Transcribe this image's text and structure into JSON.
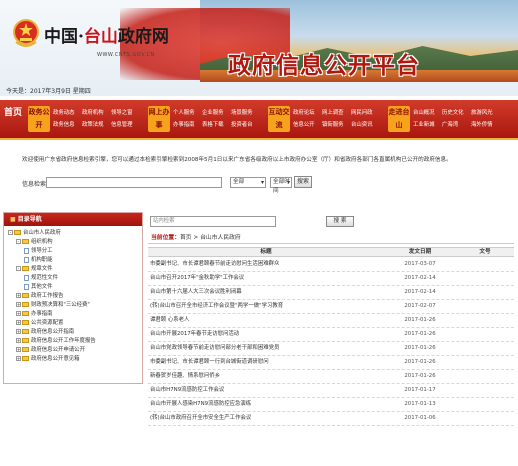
{
  "header": {
    "title_prefix": "中国·",
    "title_city": "台山",
    "title_suffix": "政府网",
    "url": "WWW.CNTS.GOV.CN",
    "platform_title": "政府信息公开平台",
    "date_line": "今天是：2017年3月9日 星期四"
  },
  "nav": {
    "home": "首页",
    "groups": [
      {
        "badge": "政务公开",
        "links": [
          "政务动态",
          "政府机构",
          "领导之窗",
          "政务信息",
          "政策法规",
          "信息管理"
        ]
      },
      {
        "badge": "网上办事",
        "links": [
          "个人服务",
          "企业服务",
          "场景服务",
          "办事指南",
          "表格下载",
          "投资者台"
        ]
      },
      {
        "badge": "互动交流",
        "links": [
          "政府论坛",
          "网上调查",
          "网民问政",
          "信息公开",
          "镇街服务",
          "台山资讯"
        ]
      },
      {
        "badge": "走进台山",
        "links": [
          "台山概况",
          "历史文化",
          "旅游风光",
          "工业新城",
          "广海湾",
          "海外侨情"
        ]
      }
    ]
  },
  "notice": "欢迎使用广东省政府信息检索引擎，您可以通过本检索引擎检索到2008年5月1日以来广东省各级政府以上市政府办公室（厅）和省政府各部门各直属机构已公开的政府信息。",
  "search1": {
    "label": "信息检索：",
    "scope": "全部",
    "time": "全部时间",
    "button": "搜索"
  },
  "sidebar": {
    "title": "目录导航",
    "tree": [
      {
        "level": 0,
        "kind": "folder",
        "box": "-",
        "label": "台山市人民政府"
      },
      {
        "level": 1,
        "kind": "folder",
        "box": "-",
        "label": "组织机构"
      },
      {
        "level": 2,
        "kind": "doc",
        "box": "",
        "label": "领导分工"
      },
      {
        "level": 2,
        "kind": "doc",
        "box": "",
        "label": "机构职能"
      },
      {
        "level": 1,
        "kind": "folder",
        "box": "-",
        "label": "规章文件"
      },
      {
        "level": 2,
        "kind": "doc",
        "box": "",
        "label": "规范性文件"
      },
      {
        "level": 2,
        "kind": "doc",
        "box": "",
        "label": "其他文件"
      },
      {
        "level": 1,
        "kind": "folder",
        "box": "+",
        "label": "政府工作报告"
      },
      {
        "level": 1,
        "kind": "folder",
        "box": "+",
        "label": "财政预决算和\"三公经费\""
      },
      {
        "level": 1,
        "kind": "folder",
        "box": "+",
        "label": "办事指南"
      },
      {
        "level": 1,
        "kind": "folder",
        "box": "+",
        "label": "公共资源配置"
      },
      {
        "level": 1,
        "kind": "folder",
        "box": "+",
        "label": "政府信息公开指南"
      },
      {
        "level": 1,
        "kind": "folder",
        "box": "+",
        "label": "政府信息公开工作年度报告"
      },
      {
        "level": 1,
        "kind": "folder",
        "box": "+",
        "label": "政府信息公开申请公开"
      },
      {
        "level": 1,
        "kind": "folder",
        "box": "+",
        "label": "政府信息公开意见箱"
      }
    ]
  },
  "main": {
    "search_placeholder": "站内检索",
    "search_button": "搜 索",
    "breadcrumb_label": "当前位置：",
    "breadcrumb": "首页 > 台山市人民政府",
    "columns": [
      "标题",
      "发文日期",
      "文号"
    ],
    "rows": [
      {
        "title": "市委副书记、市长谭君颐春节前走访慰问生活困难群众",
        "date": "2017-03-07",
        "no": ""
      },
      {
        "title": "台山市召开2017年\"金秋助学\"工作会议",
        "date": "2017-02-14",
        "no": ""
      },
      {
        "title": "台山市第十六届人大三次会议胜利闭幕",
        "date": "2017-02-14",
        "no": ""
      },
      {
        "title": "(转)台山市召开全市经济工作会议暨\"两学一做\"学习教育",
        "date": "2017-02-07",
        "no": ""
      },
      {
        "title": "谭君颐 心系老人",
        "date": "2017-01-26",
        "no": ""
      },
      {
        "title": "台山市开展2017年春节走访慰问活动",
        "date": "2017-01-26",
        "no": ""
      },
      {
        "title": "台山市党政领导春节前走访慰问部分老干部和困难党员",
        "date": "2017-01-26",
        "no": ""
      },
      {
        "title": "市委副书记、市长谭君颐一行到台城街道调研慰问",
        "date": "2017-01-26",
        "no": ""
      },
      {
        "title": "新春贺岁佳趣、情系慰问侨乡",
        "date": "2017-01-26",
        "no": ""
      },
      {
        "title": "台山市H7N9流感防控工作会议",
        "date": "2017-01-17",
        "no": ""
      },
      {
        "title": "台山市开展人感染H7N9流感防控应急演练",
        "date": "2017-01-13",
        "no": ""
      },
      {
        "title": "(转)台山市政府召开全市安全生产工作会议",
        "date": "2017-01-06",
        "no": ""
      }
    ]
  }
}
